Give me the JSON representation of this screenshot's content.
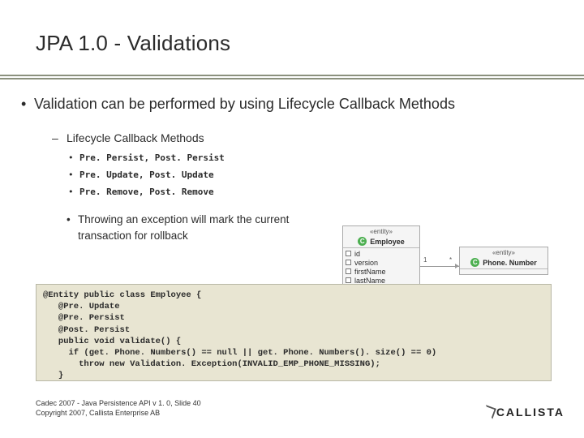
{
  "title": "JPA 1.0 - Validations",
  "bullet1": "Validation can be performed by using Lifecycle Callback Methods",
  "sub_heading": "Lifecycle Callback Methods",
  "callbacks": [
    "Pre. Persist, Post. Persist",
    "Pre. Update, Post. Update",
    "Pre. Remove, Post. Remove"
  ],
  "note": "Throwing an exception will mark the current transaction for rollback",
  "code": "@Entity public class Employee {\n   @Pre. Update\n   @Pre. Persist\n   @Post. Persist\n   public void validate() {\n     if (get. Phone. Numbers() == null || get. Phone. Numbers(). size() == 0)\n       throw new Validation. Exception(INVALID_EMP_PHONE_MISSING);\n   }",
  "uml": {
    "stereotype": "«entity»",
    "employee": {
      "name": "Employee",
      "attrs": [
        "id",
        "version",
        "firstName",
        "lastName"
      ]
    },
    "phone": {
      "name": "Phone. Number"
    },
    "mult_left": "1",
    "mult_right": "*"
  },
  "footer_line1": "Cadec 2007 - Java Persistence API v 1. 0, Slide 40",
  "footer_line2": "Copyright 2007, Callista Enterprise AB",
  "logo_text": "CALLISTA"
}
